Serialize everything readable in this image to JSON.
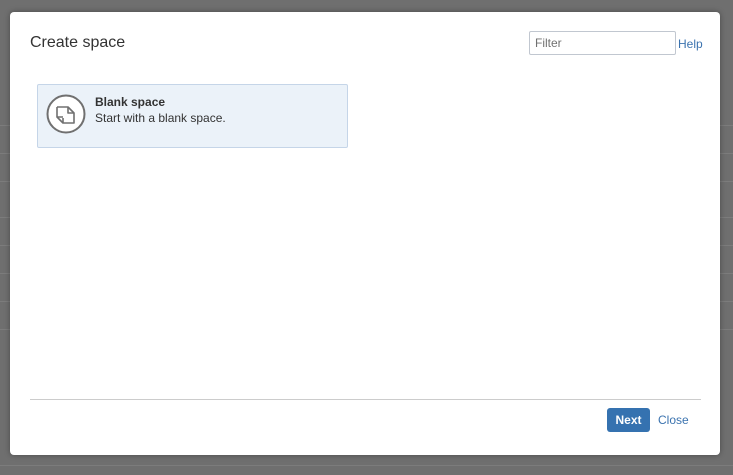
{
  "dialog": {
    "title": "Create space",
    "filter": {
      "placeholder": "Filter",
      "value": ""
    },
    "help_label": "Help"
  },
  "templates": [
    {
      "name": "Blank space",
      "description": "Start with a blank space.",
      "icon": "blank-page-icon",
      "selected": true
    }
  ],
  "footer": {
    "next_label": "Next",
    "close_label": "Close"
  },
  "colors": {
    "overlay": "#6f6f6f",
    "primary": "#3572b0",
    "link": "#3b73af",
    "selected_card": "#ebf2f9"
  }
}
